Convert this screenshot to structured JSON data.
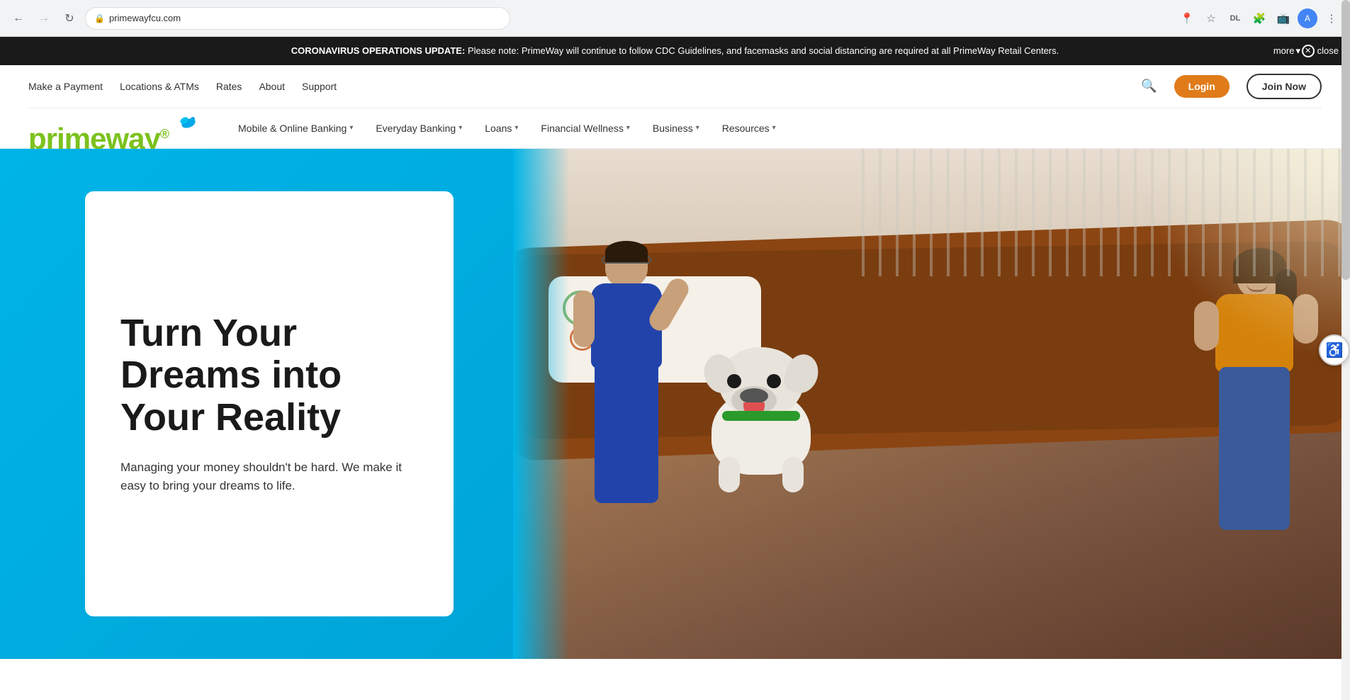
{
  "browser": {
    "url": "primewayfcu.com",
    "back_disabled": false,
    "forward_disabled": true
  },
  "announcement": {
    "title": "CORONAVIRUS OPERATIONS UPDATE:",
    "body": "Please note: PrimeWay will continue to follow CDC Guidelines, and facemasks and social distancing are required at all PrimeWay Retail Centers.",
    "close_label": "close",
    "more_label": "more"
  },
  "header": {
    "top_nav": {
      "make_payment": "Make a Payment",
      "locations_atms": "Locations & ATMs",
      "rates": "Rates",
      "about": "About",
      "support": "Support"
    },
    "login_label": "Login",
    "join_label": "Join Now",
    "logo_text": "primeway",
    "logo_tm": "®"
  },
  "main_nav": {
    "items": [
      {
        "label": "Mobile & Online Banking",
        "has_dropdown": true
      },
      {
        "label": "Everyday Banking",
        "has_dropdown": true
      },
      {
        "label": "Loans",
        "has_dropdown": true
      },
      {
        "label": "Financial Wellness",
        "has_dropdown": true
      },
      {
        "label": "Business",
        "has_dropdown": true
      },
      {
        "label": "Resources",
        "has_dropdown": true
      }
    ]
  },
  "hero": {
    "heading": "Turn Your Dreams into Your Reality",
    "subtext": "Managing your money shouldn't be hard. We make it easy to bring your dreams to life."
  },
  "accessibility": {
    "label": "♿"
  }
}
